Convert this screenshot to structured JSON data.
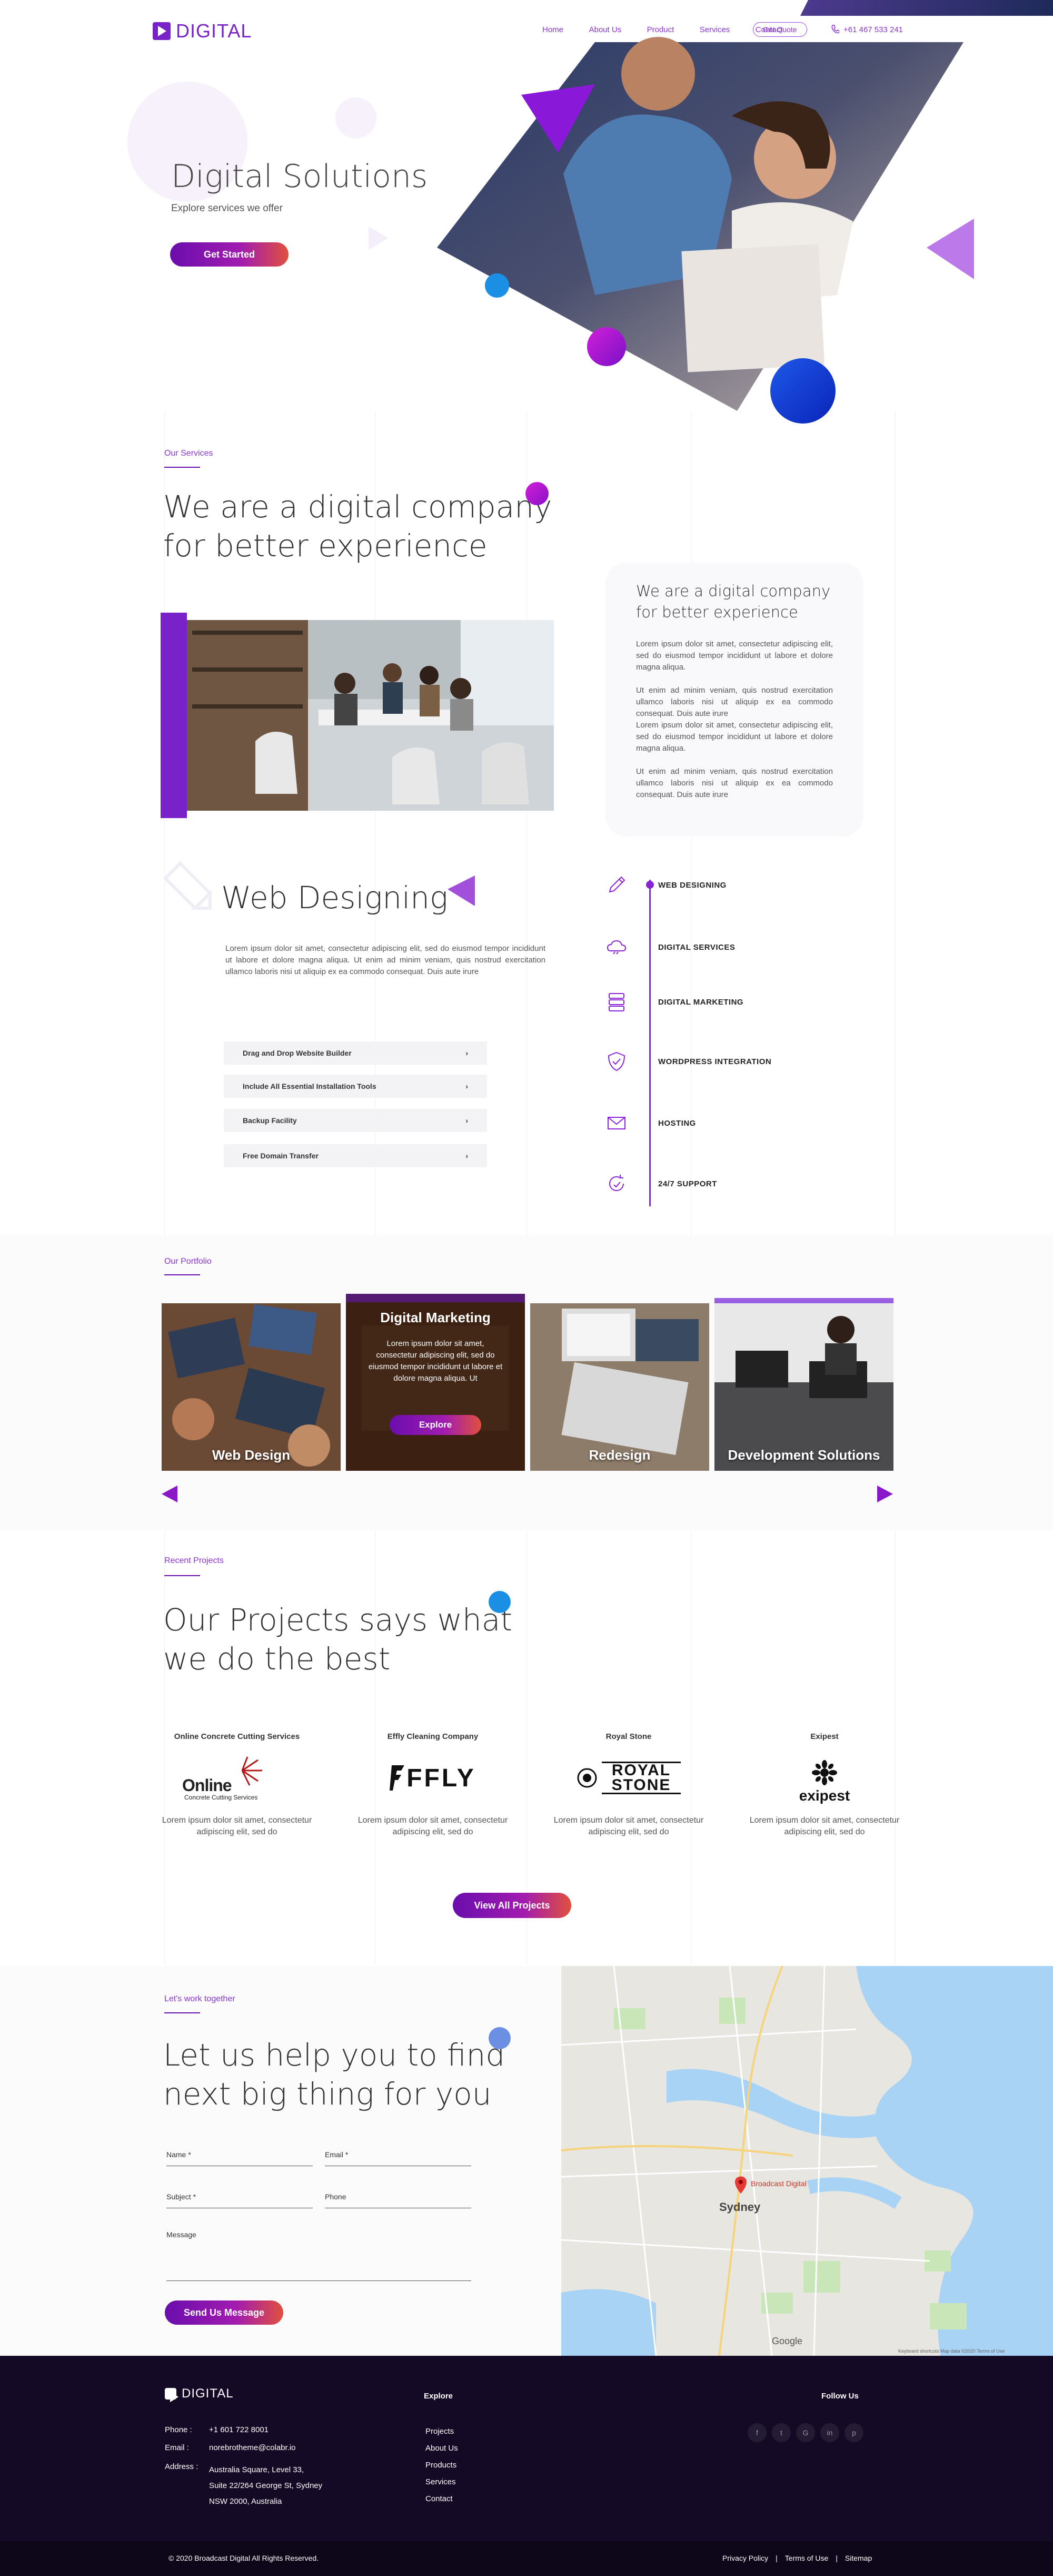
{
  "header": {
    "logo_text": "DIGITAL",
    "nav": [
      "Home",
      "About Us",
      "Product",
      "Services",
      "Contact"
    ],
    "quote_label": "Get Quote",
    "phone": "+61 467 533 241"
  },
  "hero": {
    "title": "Digital Solutions",
    "subtitle": "Explore services we offer",
    "cta": "Get Started"
  },
  "about": {
    "eyebrow": "Our Services",
    "heading_line1": "We are a digital company",
    "heading_line2": "for better experience",
    "card_title_line1": "We are a digital company",
    "card_title_line2": "for better experience",
    "paragraphs": [
      "Lorem ipsum dolor sit amet, consectetur adipiscing elit, sed do eiusmod tempor incididunt ut labore et dolore magna aliqua.",
      "Ut enim ad minim veniam, quis nostrud exercitation ullamco laboris nisi ut aliquip ex ea commodo consequat. Duis aute irure",
      "Lorem ipsum dolor sit amet, consectetur adipiscing elit, sed do eiusmod tempor incididunt ut labore et dolore magna aliqua.",
      "Ut enim ad minim veniam, quis nostrud exercitation ullamco laboris nisi ut aliquip ex ea commodo consequat. Duis aute irure"
    ]
  },
  "web_design": {
    "title": "Web Designing",
    "paragraph": "Lorem ipsum dolor sit amet, consectetur adipiscing elit, sed do eiusmod tempor incididunt ut labore et dolore magna aliqua. Ut enim ad minim veniam, quis nostrud exercitation ullamco laboris nisi ut aliquip ex ea commodo consequat. Duis aute irure",
    "features": [
      "Drag and Drop Website Builder",
      "Include All Essential Installation Tools",
      "Backup Facility",
      "Free Domain Transfer"
    ],
    "services": [
      {
        "label": "WEB DESIGNING",
        "icon": "pencil-icon"
      },
      {
        "label": "DIGITAL SERVICES",
        "icon": "cloud-icon"
      },
      {
        "label": "DIGITAL MARKETING",
        "icon": "server-icon"
      },
      {
        "label": "WORDPRESS INTEGRATION",
        "icon": "shield-icon"
      },
      {
        "label": "HOSTING",
        "icon": "mail-icon"
      },
      {
        "label": "24/7 SUPPORT",
        "icon": "support-icon"
      }
    ]
  },
  "portfolio": {
    "eyebrow": "Our Portfolio",
    "cards": [
      "Web Design",
      "Digital Marketing",
      "Redesign",
      "Development Solutions"
    ],
    "featured_text": "Lorem ipsum dolor sit amet, consectetur adipiscing elit, sed do eiusmod tempor incididunt ut labore et dolore magna aliqua. Ut",
    "featured_button": "Explore"
  },
  "projects": {
    "eyebrow": "Recent Projects",
    "heading_line1": "Our Projects says what",
    "heading_line2": "we do the best",
    "items": [
      {
        "name": "Online Concrete Cutting Services",
        "logo": "Online",
        "logo_sub": "Concrete Cutting Services",
        "desc": "Lorem ipsum dolor sit amet, consectetur adipiscing elit, sed do"
      },
      {
        "name": "Effly Cleaning Company",
        "logo": "FFLY",
        "desc": "Lorem ipsum dolor sit amet, consectetur adipiscing elit, sed do"
      },
      {
        "name": "Royal Stone",
        "logo": "ROYAL STONE",
        "desc": "Lorem ipsum dolor sit amet, consectetur adipiscing elit, sed do"
      },
      {
        "name": "Exipest",
        "logo": "exipest",
        "desc": "Lorem ipsum dolor sit amet, consectetur adipiscing elit, sed do"
      }
    ],
    "cta": "View All Projects"
  },
  "contact": {
    "eyebrow": "Let's work together",
    "heading_line1": "Let us help you to find",
    "heading_line2": "next big thing for you",
    "fields": {
      "name": "Name *",
      "email": "Email *",
      "subject": "Subject *",
      "phone": "Phone",
      "message": "Message"
    },
    "submit": "Send Us Message",
    "map_labels": {
      "city": "Sydney",
      "pin": "Broadcast Digital",
      "google": "Google",
      "attribution": "Keyboard shortcuts  Map data ©2020  Terms of Use"
    }
  },
  "footer": {
    "logo_text": "DIGITAL",
    "phone_label": "Phone :",
    "phone": "+1 601 722 8001",
    "email_label": "Email :",
    "email": "norebrotheme@colabr.io",
    "address_label": "Address :",
    "address_lines": [
      "Australia Square, Level 33,",
      "Suite 22/264 George St, Sydney",
      "NSW 2000, Australia"
    ],
    "explore_title": "Explore",
    "explore_links": [
      "Projects",
      "About Us",
      "Products",
      "Services",
      "Contact"
    ],
    "follow_title": "Follow Us",
    "social": [
      "f",
      "t",
      "G",
      "in",
      "p"
    ],
    "copyright": "© 2020 Broadcast Digital  All Rights Reserved.",
    "bottom_links": [
      "Privacy Policy",
      "Terms of Use",
      "Sitemap"
    ]
  },
  "colors": {
    "accent": "#7a22c9",
    "footer_bg": "#150a26",
    "dot_magenta": "#c017d0",
    "dot_blue": "#1a8fe3"
  }
}
